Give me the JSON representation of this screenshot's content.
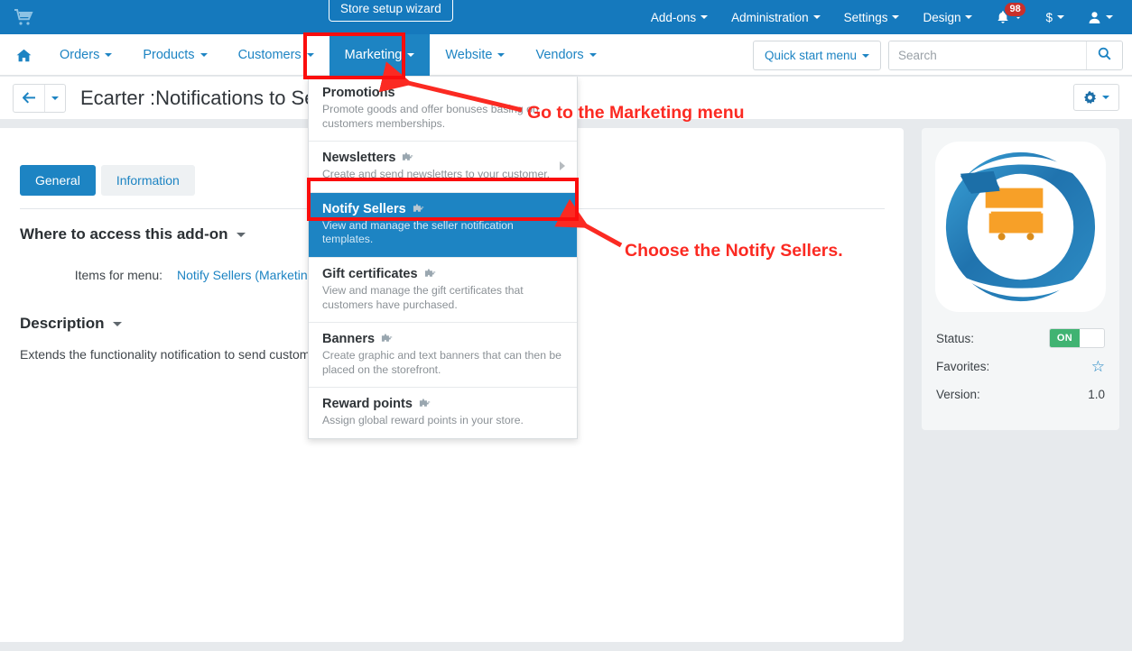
{
  "topbar": {
    "cart_icon": "shopping-cart-icon",
    "wizard_label": "Store setup wizard",
    "menu": [
      {
        "label": "Add-ons"
      },
      {
        "label": "Administration"
      },
      {
        "label": "Settings"
      },
      {
        "label": "Design"
      }
    ],
    "notifications": {
      "icon": "bell-icon",
      "count": "98"
    },
    "currency": {
      "label": "$"
    },
    "account": {
      "icon": "user-icon"
    }
  },
  "navbar": {
    "home_icon": "home-icon",
    "items": [
      {
        "label": "Orders"
      },
      {
        "label": "Products"
      },
      {
        "label": "Customers"
      },
      {
        "label": "Marketing"
      },
      {
        "label": "Website"
      },
      {
        "label": "Vendors"
      }
    ],
    "active_item": "Marketing",
    "quick_start_label": "Quick start menu",
    "search": {
      "value": "",
      "placeholder": "Search",
      "icon": "search-icon"
    }
  },
  "titlebar": {
    "back_icon": "arrow-left-icon",
    "back_caret_icon": "chevron-down-icon",
    "title": "Ecarter :Notifications to Sellers",
    "gear_icon": "gear-icon",
    "gear_caret_icon": "chevron-down-icon"
  },
  "main": {
    "tabs": [
      {
        "label": "General",
        "active": true
      },
      {
        "label": "Information",
        "active": false
      }
    ],
    "access_section": {
      "heading": "Where to access this add-on",
      "caret_icon": "caret-down-icon",
      "field_label": "Items for menu:",
      "field_value": "Notify Sellers (Marketing)"
    },
    "description_section": {
      "heading": "Description",
      "caret_icon": "caret-down-icon",
      "text": "Extends the functionality notification to send custom notifications to sellers."
    }
  },
  "sidebar": {
    "logo_icon": "ecarter-cart-logo",
    "rows": [
      {
        "label": "Status:",
        "value": "ON",
        "type": "toggle"
      },
      {
        "label": "Favorites:",
        "value": "☆",
        "type": "star"
      },
      {
        "label": "Version:",
        "value": "1.0",
        "type": "text"
      }
    ]
  },
  "dropdown": {
    "items": [
      {
        "title": "Promotions",
        "desc": "Promote goods and offer bonuses basing on customers memberships.",
        "addon": false,
        "submenu": false,
        "selected": false
      },
      {
        "title": "Newsletters",
        "desc": "Create and send newsletters to your customer.",
        "addon": true,
        "submenu": true,
        "selected": false
      },
      {
        "title": "Notify Sellers",
        "desc": "View and manage the seller notification templates.",
        "addon": true,
        "submenu": false,
        "selected": true
      },
      {
        "title": "Gift certificates",
        "desc": "View and manage the gift certificates that customers have purchased.",
        "addon": true,
        "submenu": false,
        "selected": false
      },
      {
        "title": "Banners",
        "desc": "Create graphic and text banners that can then be placed on the storefront.",
        "addon": true,
        "submenu": false,
        "selected": false
      },
      {
        "title": "Reward points",
        "desc": "Assign global reward points in your store.",
        "addon": true,
        "submenu": false,
        "selected": false
      }
    ]
  },
  "annotations": {
    "callout_1": "Go to the Marketing menu",
    "callout_2": "Choose the Notify Sellers.",
    "highlight_color": "#fb0d0d",
    "text_color": "#fb2a22"
  },
  "colors": {
    "header_blue": "#1579bd",
    "accent_blue": "#1d84c3",
    "page_bg": "#e7eaed",
    "toggle_green": "#40b372",
    "badge_red": "#c9302c"
  }
}
